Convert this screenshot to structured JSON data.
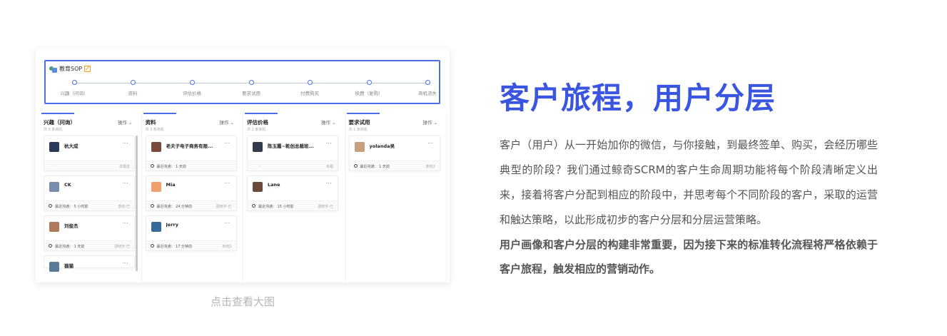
{
  "sop": {
    "title": "教育SOP",
    "stages": [
      "兴趣（问询）",
      "资料",
      "评估价格",
      "要求试用",
      "付费购买",
      "续费（复购）",
      "商机流失"
    ]
  },
  "columns": [
    {
      "name": "兴趣（问询）",
      "op": "操作",
      "count": "共 5 条商机",
      "cards": [
        {
          "name": "杭大成",
          "sub": "-",
          "foot": "",
          "tag": "未跟进",
          "dash": "--"
        },
        {
          "name": "CK",
          "sub": "-",
          "foot": "最近沟通：  5 小时前",
          "tag": "李晓-已"
        },
        {
          "name": "刘俊杰",
          "sub": "-",
          "foot": "最近沟通：  1 天前",
          "tag": "邵晓宇-已"
        },
        {
          "name": "猫猫",
          "sub": "",
          "foot": "",
          "tag": ""
        }
      ]
    },
    {
      "name": "资料",
      "op": "操作",
      "count": "共 3 条商机",
      "cards": [
        {
          "name": "老夫子电子商务有限...",
          "sub": "-",
          "foot": "最近沟通：  1 天前",
          "tag": ""
        },
        {
          "name": "Mia",
          "sub": "-",
          "foot": "最近沟通：  24 分钟前",
          "tag": "邵晓宇-已"
        },
        {
          "name": "Jerry",
          "sub": "-",
          "foot": "最近沟通：  17 分钟前",
          "tag": "朱晓2"
        }
      ]
    },
    {
      "name": "评估价格",
      "op": "操作",
      "count": "共 2 条商机",
      "cards": [
        {
          "name": "陈玉霞~乾创总裁班...",
          "sub": "-",
          "foot": "",
          "tag": "未跟",
          "dash": "--"
        },
        {
          "name": "Lane",
          "sub": "-",
          "foot": "最近沟通：  15 小时前",
          "tag": "邵晓宇-已"
        }
      ]
    },
    {
      "name": "要求试用",
      "op": "操作",
      "count": "共 1 条商机",
      "cards": [
        {
          "name": "yolanda吴",
          "sub": "-",
          "foot": "最近沟通：  1 天前",
          "tag": "李晓2"
        }
      ]
    }
  ],
  "caption": "点击查看大图",
  "headline": "客户旅程，用户分层",
  "paragraph": "客户（用户）从一开始加你的微信，与你接触，到最终签单、购买，会经历哪些典型的阶段？我们通过鲸奇SCRM的客户生命周期功能将每个阶段清晰定义出来，接着将客户分配到相应的阶段中，并思考每个不同阶段的客户，采取的运营和触达策略，以此形成初步的客户分层和分层运营策略。",
  "paragraph2": "用户画像和客户分层的构建非常重要，因为接下来的标准转化流程将严格依赖于客户旅程，触发相应的营销动作。",
  "colors": {
    "accent": "#3a55e0",
    "stage_border": "#4a6fe8"
  }
}
